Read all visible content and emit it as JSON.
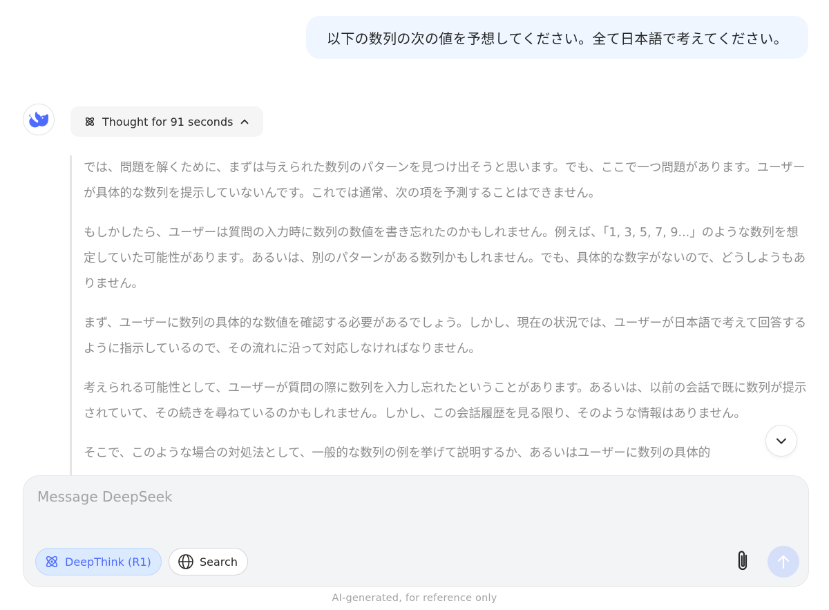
{
  "user_message": "以下の数列の次の値を予想してください。全て日本語で考えてください。",
  "assistant": {
    "avatar_icon": "deepseek-whale-icon",
    "thought_toggle_label": "Thought for 91 seconds",
    "thought_toggle_icon": "atom-icon",
    "thought_paragraphs": [
      "では、問題を解くために、まずは与えられた数列のパターンを見つけ出そうと思います。でも、ここで一つ問題があります。ユーザーが具体的な数列を提示していないんです。これでは通常、次の項を予測することはできません。",
      "もしかしたら、ユーザーは質問の入力時に数列の数値を書き忘れたのかもしれません。例えば、「1, 3, 5, 7, 9...」のような数列を想定していた可能性があります。あるいは、別のパターンがある数列かもしれません。でも、具体的な数字がないので、どうしようもありません。",
      "まず、ユーザーに数列の具体的な数値を確認する必要があるでしょう。しかし、現在の状況では、ユーザーが日本語で考えて回答するように指示しているので、その流れに沿って対応しなければなりません。",
      "考えられる可能性として、ユーザーが質問の際に数列を入力し忘れたということがあります。あるいは、以前の会話で既に数列が提示されていて、その続きを尋ねているのかもしれません。しかし、この会話履歴を見る限り、そのような情報はありません。",
      "そこで、このような場合の対処法として、一般的な数列の例を挙げて説明するか、あるいはユーザーに数列の具体的"
    ]
  },
  "composer": {
    "placeholder": "Message DeepSeek",
    "deepthink_label": "DeepThink (R1)",
    "search_label": "Search"
  },
  "footer_note": "AI-generated, for reference only",
  "colors": {
    "accent": "#4d6bfe",
    "user_bubble": "#eff6ff",
    "thought_text": "#8b8b8b"
  }
}
